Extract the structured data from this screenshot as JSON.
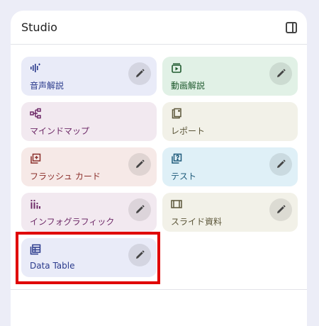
{
  "studio": {
    "title": "Studio"
  },
  "cards": {
    "audio_overview": {
      "label": "音声解説",
      "icon": "audio-waveform-icon",
      "bg": "#e9ebf8",
      "fg": "#2a3a8c"
    },
    "video_overview": {
      "label": "動画解説",
      "icon": "video-play-icon",
      "bg": "#e1f1e6",
      "fg": "#1f5a2e"
    },
    "mind_map": {
      "label": "マインドマップ",
      "icon": "mind-map-icon",
      "bg": "#f2e9f0",
      "fg": "#6e2a68"
    },
    "report": {
      "label": "レポート",
      "icon": "report-icon",
      "bg": "#f2f1e8",
      "fg": "#5b5538"
    },
    "flashcards": {
      "label": "フラッシュ カード",
      "icon": "flashcards-icon",
      "bg": "#f6e9e7",
      "fg": "#8a2e2a"
    },
    "quiz": {
      "label": "テスト",
      "icon": "quiz-icon",
      "bg": "#dff0f7",
      "fg": "#1e5a7a"
    },
    "infographic": {
      "label": "インフォグラフィック",
      "icon": "infographic-icon",
      "bg": "#f2e9f0",
      "fg": "#6e2a68"
    },
    "slides": {
      "label": "スライド資料",
      "icon": "slides-icon",
      "bg": "#f2f1e8",
      "fg": "#5b5538"
    },
    "data_table": {
      "label": "Data Table",
      "icon": "table-icon",
      "bg": "#e9ebf8",
      "fg": "#2a3a8c"
    }
  },
  "highlight_color": "#e00000"
}
